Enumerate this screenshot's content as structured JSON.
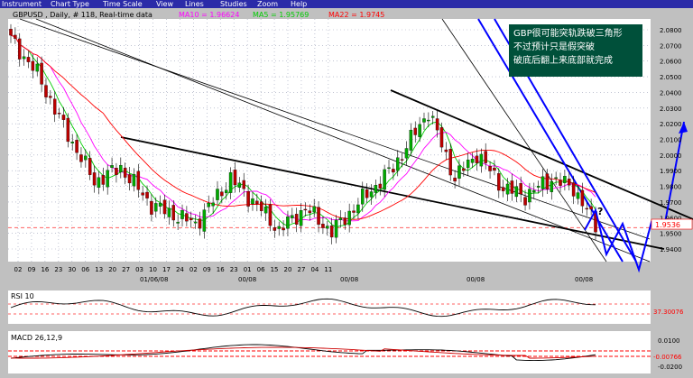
{
  "menu": [
    "Instrument",
    "Chart Type",
    "Time Scale",
    "View",
    "Lines",
    "Studies",
    "Zoom",
    "Help"
  ],
  "chart_data": {
    "type": "candlestick",
    "title": "GBPUSD , Daily, # 118, Real-time data",
    "moving_averages": [
      {
        "name": "MA10",
        "value": "1.96624",
        "color": "#ff00ff"
      },
      {
        "name": "MA5",
        "value": "1.95769",
        "color": "#00cc00"
      },
      {
        "name": "MA22",
        "value": "1.9745",
        "color": "#ff0000"
      }
    ],
    "y_ticks": [
      "2.0800",
      "2.0700",
      "2.0600",
      "2.0500",
      "2.0400",
      "2.0300",
      "2.0200",
      "2.0100",
      "2.0000",
      "1.9900",
      "1.9800",
      "1.9700",
      "1.9600",
      "1.9500",
      "1.9400"
    ],
    "ylim": [
      1.9326,
      2.0837
    ],
    "last_price_label": "1.9536",
    "last_price": 1.9536,
    "x_ticks": [
      "02",
      "09",
      "16",
      "23",
      "30",
      "06",
      "13",
      "20",
      "27",
      "03",
      "10",
      "17",
      "24",
      "02",
      "09",
      "16",
      "23",
      "01",
      "06",
      "15",
      "20",
      "27",
      "04",
      "11"
    ],
    "month_labels": [
      "01/06/08",
      "00/08",
      "00/08",
      "00/08",
      "00/08"
    ],
    "grid": true
  },
  "annotation": {
    "lines": [
      "GBP很可能突轨跌破三角形",
      "不过预计只是假突破",
      "破底后翻上来底部就完成"
    ],
    "question_mark": "?"
  },
  "rsi": {
    "title": "RSI 10",
    "value_label": "37.30076"
  },
  "macd": {
    "title": "MACD 26,12,9",
    "ticks": [
      "0.0100",
      "-0.00766",
      "-0.0200"
    ]
  },
  "colors": {
    "bull": "#00aa00",
    "bear": "#bb0000",
    "trendline": "#000000",
    "projection": "#0000ff",
    "frame_bg": "#c0c0c0",
    "plot_bg": "#ffffff"
  }
}
